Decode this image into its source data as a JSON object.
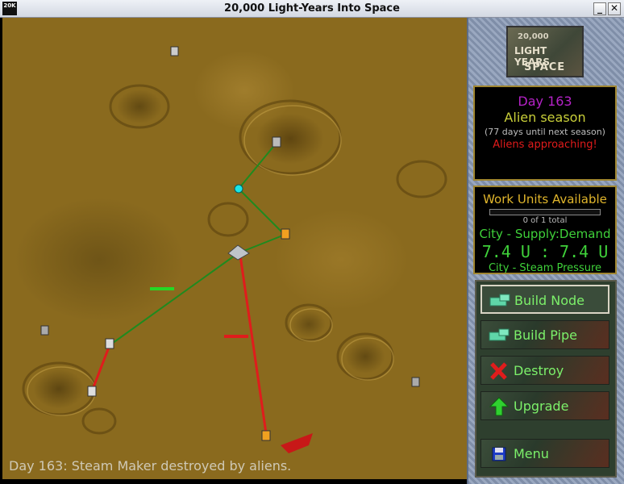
{
  "window": {
    "title": "20,000 Light-Years Into Space",
    "icon_text": "20K",
    "minimize_glyph": "_",
    "close_glyph": "✕"
  },
  "logo": {
    "line1": "20,000",
    "line2": "LIGHT YEARS",
    "line3": "SPACE"
  },
  "info": {
    "day": "Day 163",
    "season": "Alien season",
    "until_next": "(77 days until next season)",
    "warning": "Aliens approaching!"
  },
  "work": {
    "title": "Work Units Available",
    "progress": 0,
    "count": "0 of 1 total",
    "supply_title": "City - Supply:Demand",
    "supply_values": "7.4 U : 7.4 U",
    "steam_title": "City - Steam Pressure"
  },
  "menu": {
    "items": [
      {
        "label": "Build Node",
        "icon": "node-icon",
        "active": true
      },
      {
        "label": "Build Pipe",
        "icon": "pipe-icon",
        "active": false
      },
      {
        "label": "Destroy",
        "icon": "red-x-icon",
        "active": false
      },
      {
        "label": "Upgrade",
        "icon": "green-up-arrow-icon",
        "active": false
      },
      {
        "label": "Menu",
        "icon": "floppy-disk-icon",
        "active": false
      }
    ]
  },
  "status_message": "Day 163: Steam Maker destroyed by aliens.",
  "colors": {
    "pipe_ok": "#1f8a1f",
    "pipe_broken": "#e01c1c",
    "node_active": "#f0a020",
    "node_highlight": "#19e6e6",
    "terrain": "#8a6a1e"
  }
}
